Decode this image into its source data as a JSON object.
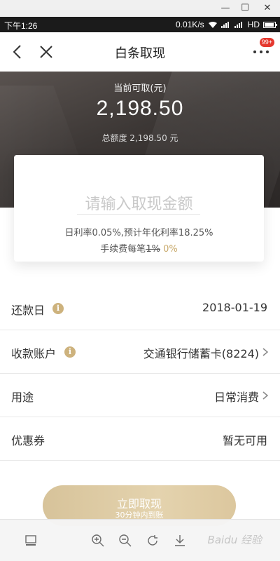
{
  "status_bar": {
    "time": "下午1:26",
    "speed": "0.01K/s",
    "network": "HD"
  },
  "nav": {
    "title": "白条取现",
    "badge": "99+"
  },
  "hero": {
    "label": "当前可取(元)",
    "amount": "2,198.50",
    "total": "总额度 2,198.50 元"
  },
  "card": {
    "placeholder": "请输入取现金额",
    "rate": "日利率0.05%,预计年化利率18.25%",
    "fee_label": "手续费每笔",
    "fee_original": "1%",
    "fee_current": "0%"
  },
  "rows": [
    {
      "label": "还款日",
      "value": "2018-01-19"
    },
    {
      "label": "收款账户",
      "value": "交通银行储蓄卡(8224)"
    },
    {
      "label": "用途",
      "value": "日常消费"
    },
    {
      "label": "优惠券",
      "value": "暂无可用"
    }
  ],
  "cta": {
    "label": "立即取现",
    "sub": "30分钟内到账"
  },
  "watermark": "Baidu 经验",
  "colors": {
    "accent_gold": "#c8a96a",
    "button_gold": "#e0cda5",
    "hero_dark": "#3c3735",
    "badge_red": "#e5382e"
  },
  "icons": [
    "minimize-icon",
    "maximize-icon",
    "window-close-icon",
    "wifi-icon",
    "signal-icon",
    "battery-icon",
    "back-icon",
    "close-icon",
    "more-icon",
    "info-icon",
    "chevron-right-icon",
    "thumbnail-icon",
    "zoom-in-icon",
    "zoom-out-icon",
    "rotate-icon",
    "download-icon"
  ]
}
